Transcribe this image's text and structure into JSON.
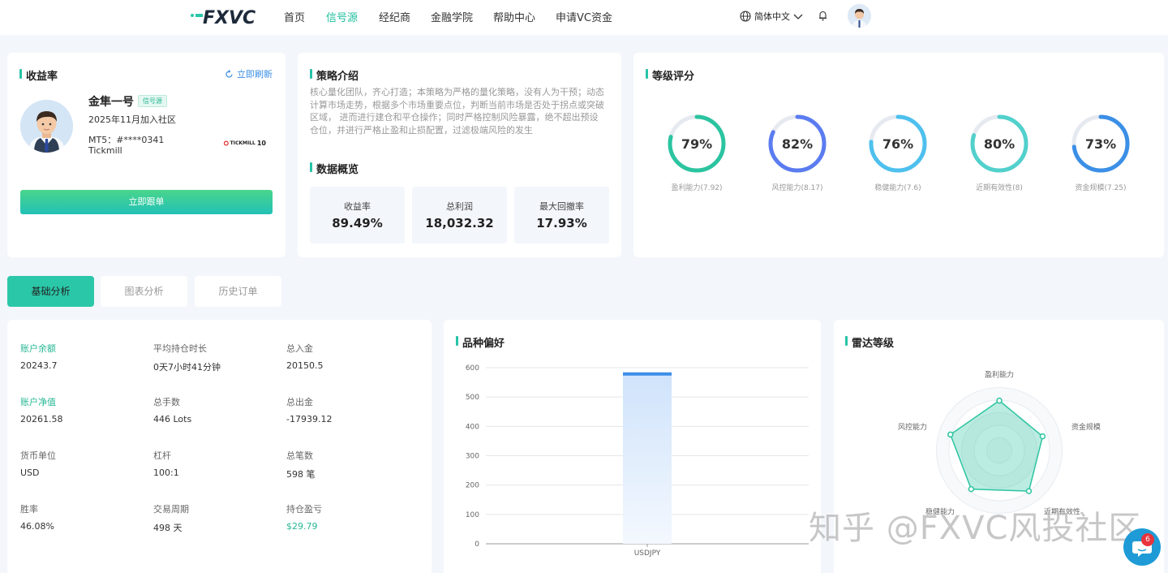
{
  "header": {
    "logo_text": "FXVC",
    "nav": [
      "首页",
      "信号源",
      "经纪商",
      "金融学院",
      "帮助中心",
      "申请VC资金"
    ],
    "active_nav_index": 1,
    "language": "简体中文",
    "icons": [
      "globe-icon",
      "chevron-down-icon",
      "bell-icon"
    ]
  },
  "profile_card": {
    "title": "收益率",
    "refresh_label": "立即刷新",
    "trader_name": "金隼一号",
    "badge": "信号源",
    "joined": "2025年11月加入社区",
    "mt5": "MT5：#****0341",
    "broker": "Tickmill",
    "broker_logo_text": "TICKMILL",
    "broker_logo_number": "10",
    "follow_label": "立即跟单"
  },
  "strategy_card": {
    "title": "策略介绍",
    "intro": "核心量化团队，齐心打造；本策略为严格的量化策略，没有人为干预；动态计算市场走势，根据多个市场重要点位，判断当前市场是否处于拐点或突破区域， 进而进行建仓和平仓操作；同时严格控制风险暴露，绝不超出预设仓位，并进行严格止盈和止损配置，过滤极端风险的发生",
    "overview_title": "数据概览",
    "stats": [
      {
        "label": "收益率",
        "value": "89.49%"
      },
      {
        "label": "总利润",
        "value": "18,032.32"
      },
      {
        "label": "最大回撤率",
        "value": "17.93%"
      }
    ]
  },
  "rating_card": {
    "title": "等级评分",
    "rings": [
      {
        "percent": 79,
        "value": "79%",
        "label": "盈利能力(7.92)",
        "color": "#2bc4a0"
      },
      {
        "percent": 82,
        "value": "82%",
        "label": "风控能力(8.17)",
        "color": "#5b7cf0"
      },
      {
        "percent": 76,
        "value": "76%",
        "label": "稳健能力(7.6)",
        "color": "#4ec0ee"
      },
      {
        "percent": 80,
        "value": "80%",
        "label": "近期有效性(8)",
        "color": "#52d0cc"
      },
      {
        "percent": 73,
        "value": "73%",
        "label": "资金规模(7.25)",
        "color": "#3b8fe6"
      }
    ]
  },
  "tabs": [
    "基础分析",
    "图表分析",
    "历史订单"
  ],
  "basic": {
    "fields": [
      {
        "label": "账户余额",
        "value": "20243.7",
        "accent": true
      },
      {
        "label": "平均持仓时长",
        "value": "0天7小时41分钟"
      },
      {
        "label": "总入金",
        "value": "20150.5"
      },
      {
        "label": "账户净值",
        "value": "20261.58",
        "accent": true
      },
      {
        "label": "总手数",
        "value": "446 Lots"
      },
      {
        "label": "总出金",
        "value": "-17939.12"
      },
      {
        "label": "货币单位",
        "value": "USD"
      },
      {
        "label": "杠杆",
        "value": "100:1"
      },
      {
        "label": "总笔数",
        "value": "598 笔"
      },
      {
        "label": "胜率",
        "value": "46.08%"
      },
      {
        "label": "交易周期",
        "value": "498 天"
      },
      {
        "label": "持仓盈亏",
        "value": "$29.79",
        "green": true
      }
    ]
  },
  "variety_card": {
    "title": "品种偏好"
  },
  "radar_card": {
    "title": "雷达等级",
    "axes": [
      "盈利能力",
      "资金规模",
      "近期有效性",
      "稳健能力",
      "风控能力"
    ],
    "values": [
      7.92,
      7.25,
      8,
      7.6,
      8.17
    ],
    "max": 10
  },
  "chart_data": {
    "type": "bar",
    "categories": [
      "USDJPY"
    ],
    "values": [
      584
    ],
    "title": "",
    "xlabel": "",
    "ylabel": "",
    "ylim": [
      0,
      600
    ],
    "yticks": [
      0,
      100,
      200,
      300,
      400,
      500,
      600
    ],
    "grid": true
  },
  "watermark": "知乎 @FXVC风投社区",
  "chat_badge": "6"
}
